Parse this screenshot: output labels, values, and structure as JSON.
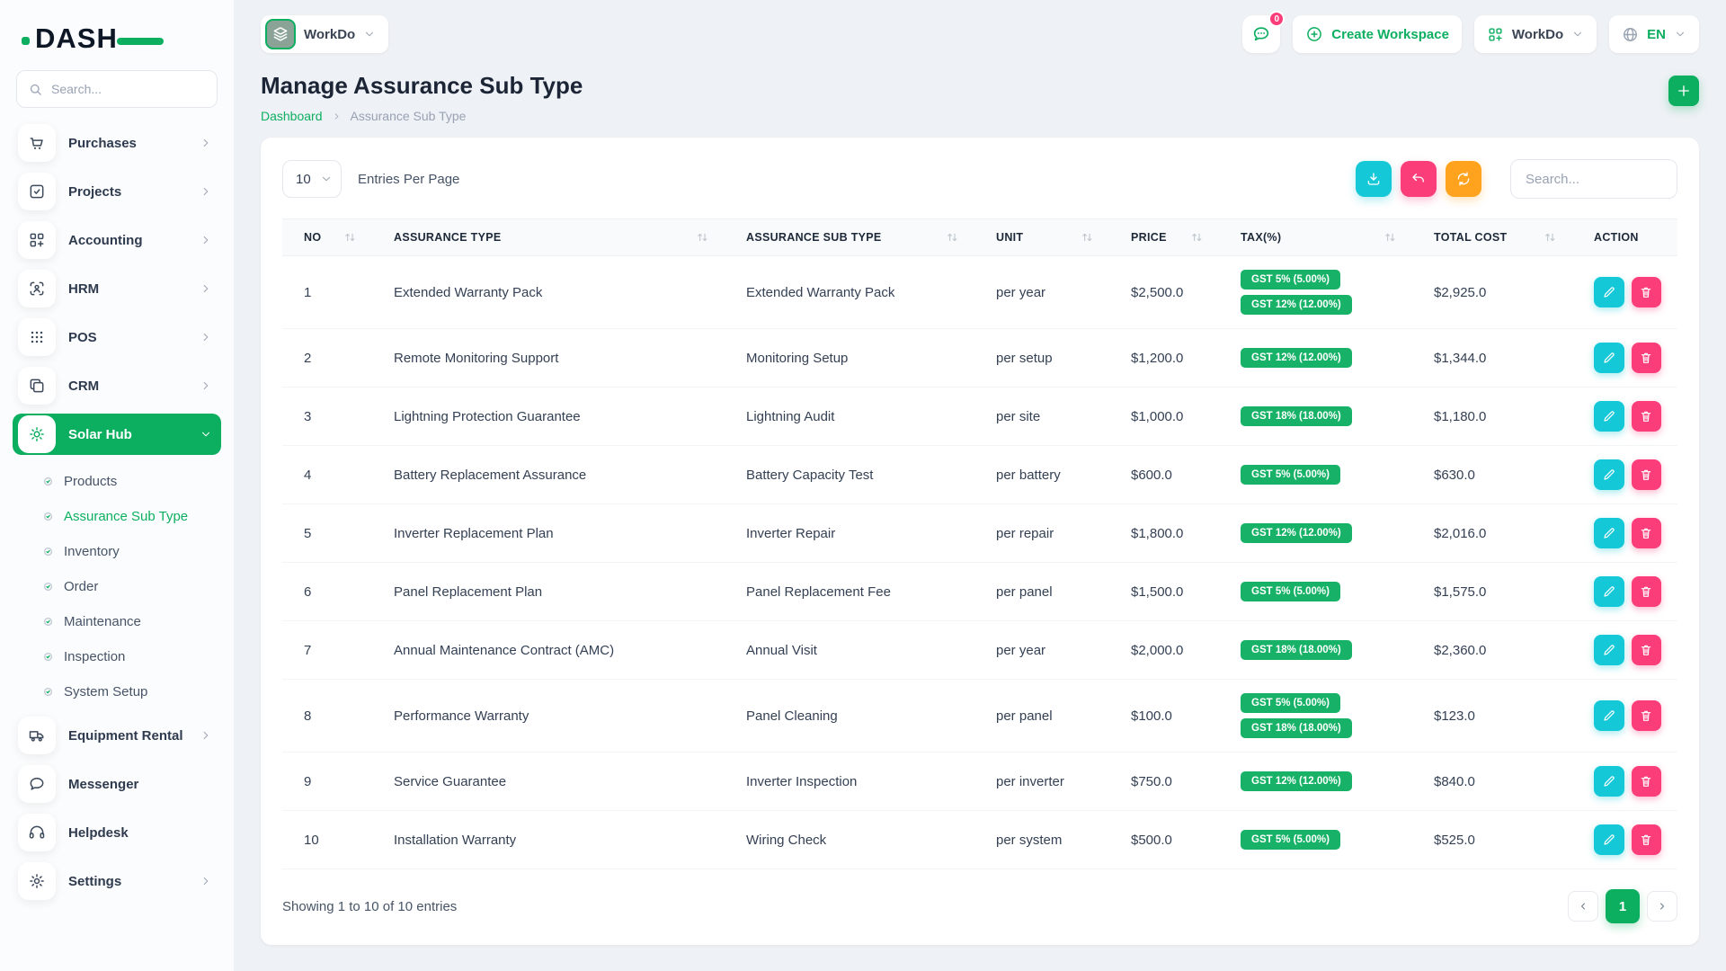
{
  "brand": {
    "logo_text": "DASH"
  },
  "sidebar": {
    "search": {
      "placeholder": "Search..."
    },
    "items": [
      {
        "label": "Purchases",
        "icon": "cart-icon",
        "chevron": true
      },
      {
        "label": "Projects",
        "icon": "checkbox-icon",
        "chevron": true
      },
      {
        "label": "Accounting",
        "icon": "grid-plus-icon",
        "chevron": true
      },
      {
        "label": "HRM",
        "icon": "user-focus-icon",
        "chevron": true
      },
      {
        "label": "POS",
        "icon": "dots-grid-icon",
        "chevron": true
      },
      {
        "label": "CRM",
        "icon": "copy-icon",
        "chevron": true
      },
      {
        "label": "Solar Hub",
        "icon": "sun-icon",
        "chevron": true,
        "active": true,
        "children": [
          {
            "label": "Products",
            "active": false
          },
          {
            "label": "Assurance Sub Type",
            "active": true
          },
          {
            "label": "Inventory",
            "active": false
          },
          {
            "label": "Order",
            "active": false
          },
          {
            "label": "Maintenance",
            "active": false
          },
          {
            "label": "Inspection",
            "active": false
          },
          {
            "label": "System Setup",
            "active": false
          }
        ]
      },
      {
        "label": "Equipment Rental",
        "icon": "truck-icon",
        "chevron": true
      },
      {
        "label": "Messenger",
        "icon": "chat-icon",
        "chevron": false
      },
      {
        "label": "Helpdesk",
        "icon": "headset-icon",
        "chevron": false
      },
      {
        "label": "Settings",
        "icon": "gear-icon",
        "chevron": true
      }
    ]
  },
  "topbar": {
    "workspace_name": "WorkDo",
    "chat_badge_count": "0",
    "create_workspace_label": "Create Workspace",
    "apps_menu_label": "WorkDo",
    "language_label": "EN"
  },
  "page": {
    "title": "Manage Assurance Sub Type",
    "breadcrumb_home": "Dashboard",
    "breadcrumb_current": "Assurance Sub Type"
  },
  "table_controls": {
    "entries_per_page_value": "10",
    "entries_per_page_label": "Entries Per Page",
    "search_placeholder": "Search..."
  },
  "table": {
    "columns": [
      {
        "label": "NO",
        "sortable": true
      },
      {
        "label": "ASSURANCE TYPE",
        "sortable": true
      },
      {
        "label": "ASSURANCE SUB TYPE",
        "sortable": true
      },
      {
        "label": "UNIT",
        "sortable": true
      },
      {
        "label": "PRICE",
        "sortable": true
      },
      {
        "label": "TAX(%)",
        "sortable": true
      },
      {
        "label": "TOTAL COST",
        "sortable": true
      },
      {
        "label": "ACTION",
        "sortable": false
      }
    ],
    "rows": [
      {
        "no": "1",
        "assurance_type": "Extended Warranty Pack",
        "assurance_sub_type": "Extended Warranty Pack",
        "unit": "per year",
        "price": "$2,500.0",
        "taxes": [
          "GST 5% (5.00%)",
          "GST 12% (12.00%)"
        ],
        "total_cost": "$2,925.0"
      },
      {
        "no": "2",
        "assurance_type": "Remote Monitoring Support",
        "assurance_sub_type": "Monitoring Setup",
        "unit": "per setup",
        "price": "$1,200.0",
        "taxes": [
          "GST 12% (12.00%)"
        ],
        "total_cost": "$1,344.0"
      },
      {
        "no": "3",
        "assurance_type": "Lightning Protection Guarantee",
        "assurance_sub_type": "Lightning Audit",
        "unit": "per site",
        "price": "$1,000.0",
        "taxes": [
          "GST 18% (18.00%)"
        ],
        "total_cost": "$1,180.0"
      },
      {
        "no": "4",
        "assurance_type": "Battery Replacement Assurance",
        "assurance_sub_type": "Battery Capacity Test",
        "unit": "per battery",
        "price": "$600.0",
        "taxes": [
          "GST 5% (5.00%)"
        ],
        "total_cost": "$630.0"
      },
      {
        "no": "5",
        "assurance_type": "Inverter Replacement Plan",
        "assurance_sub_type": "Inverter Repair",
        "unit": "per repair",
        "price": "$1,800.0",
        "taxes": [
          "GST 12% (12.00%)"
        ],
        "total_cost": "$2,016.0"
      },
      {
        "no": "6",
        "assurance_type": "Panel Replacement Plan",
        "assurance_sub_type": "Panel Replacement Fee",
        "unit": "per panel",
        "price": "$1,500.0",
        "taxes": [
          "GST 5% (5.00%)"
        ],
        "total_cost": "$1,575.0"
      },
      {
        "no": "7",
        "assurance_type": "Annual Maintenance Contract (AMC)",
        "assurance_sub_type": "Annual Visit",
        "unit": "per year",
        "price": "$2,000.0",
        "taxes": [
          "GST 18% (18.00%)"
        ],
        "total_cost": "$2,360.0"
      },
      {
        "no": "8",
        "assurance_type": "Performance Warranty",
        "assurance_sub_type": "Panel Cleaning",
        "unit": "per panel",
        "price": "$100.0",
        "taxes": [
          "GST 5% (5.00%)",
          "GST 18% (18.00%)"
        ],
        "total_cost": "$123.0"
      },
      {
        "no": "9",
        "assurance_type": "Service Guarantee",
        "assurance_sub_type": "Inverter Inspection",
        "unit": "per inverter",
        "price": "$750.0",
        "taxes": [
          "GST 12% (12.00%)"
        ],
        "total_cost": "$840.0"
      },
      {
        "no": "10",
        "assurance_type": "Installation Warranty",
        "assurance_sub_type": "Wiring Check",
        "unit": "per system",
        "price": "$500.0",
        "taxes": [
          "GST 5% (5.00%)"
        ],
        "total_cost": "$525.0"
      }
    ]
  },
  "table_footer": {
    "showing_text": "Showing 1 to 10 of 10 entries",
    "current_page": "1"
  },
  "colors": {
    "primary_green": "#0caf60",
    "badge_green": "#17b267",
    "cyan": "#15c8d8",
    "pink": "#fb3e7a",
    "orange": "#ffa21d"
  }
}
